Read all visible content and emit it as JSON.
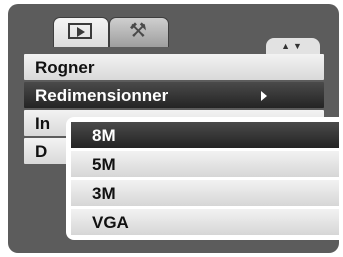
{
  "tabs": [
    {
      "name": "playback",
      "icon": "play-icon"
    },
    {
      "name": "setup",
      "icon": "wrench-icon"
    }
  ],
  "scroll_indicator": "▲▼",
  "menu": {
    "items": [
      {
        "label": "Rogner"
      },
      {
        "label": "Redimensionner"
      },
      {
        "label": "In"
      },
      {
        "label": "D"
      }
    ],
    "selected_index": 1
  },
  "submenu": {
    "items": [
      {
        "label": "8M"
      },
      {
        "label": "5M"
      },
      {
        "label": "3M"
      },
      {
        "label": "VGA"
      }
    ],
    "selected_index": 0
  },
  "colors": {
    "screen_background": "#5c5c5c",
    "highlight": "#2e2e2e",
    "row": "#e4e4e4"
  }
}
